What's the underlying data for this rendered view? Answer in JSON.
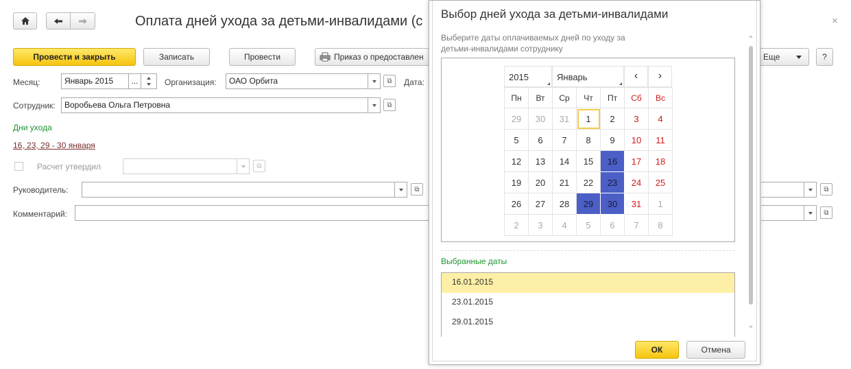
{
  "toolbar": {
    "title": "Оплата дней ухода за детьми-инвалидами (с",
    "post_close": "Провести и закрыть",
    "save": "Записать",
    "post": "Провести",
    "order": "Приказ о предоставлен",
    "more": "Еще",
    "help": "?"
  },
  "form": {
    "month_label": "Месяц:",
    "month_value": "Январь 2015",
    "month_dots": "...",
    "org_label": "Организация:",
    "org_value": "ОАО Орбита",
    "date_label": "Дата:",
    "employee_label": "Сотрудник:",
    "employee_value": "Воробьева Ольга Петровна",
    "care_days_label": "Дни ухода",
    "care_days_value": "16, 23, 29 - 30 января",
    "approved_label": "Расчет утвердил",
    "manager_label": "Руководитель:",
    "comment_label": "Комментарий:"
  },
  "dialog": {
    "title": "Выбор дней ухода за детьми-инвалидами",
    "hint": "Выберите даты оплачиваемых дней по уходу за детьми-инвалидами сотруднику",
    "year": "2015",
    "month": "Январь",
    "prev": "‹",
    "next": "›",
    "weekdays": [
      "Пн",
      "Вт",
      "Ср",
      "Чт",
      "Пт",
      "Сб",
      "Вс"
    ],
    "weeks": [
      [
        "29",
        "30",
        "31",
        "1",
        "2",
        "3",
        "4"
      ],
      [
        "5",
        "6",
        "7",
        "8",
        "9",
        "10",
        "11"
      ],
      [
        "12",
        "13",
        "14",
        "15",
        "16",
        "17",
        "18"
      ],
      [
        "19",
        "20",
        "21",
        "22",
        "23",
        "24",
        "25"
      ],
      [
        "26",
        "27",
        "28",
        "29",
        "30",
        "31",
        "1"
      ],
      [
        "2",
        "3",
        "4",
        "5",
        "6",
        "7",
        "8"
      ]
    ],
    "selected_label": "Выбранные даты",
    "selected_dates": [
      "16.01.2015",
      "23.01.2015",
      "29.01.2015"
    ],
    "ok": "ОК",
    "cancel": "Отмена"
  },
  "close_glyph": "×"
}
